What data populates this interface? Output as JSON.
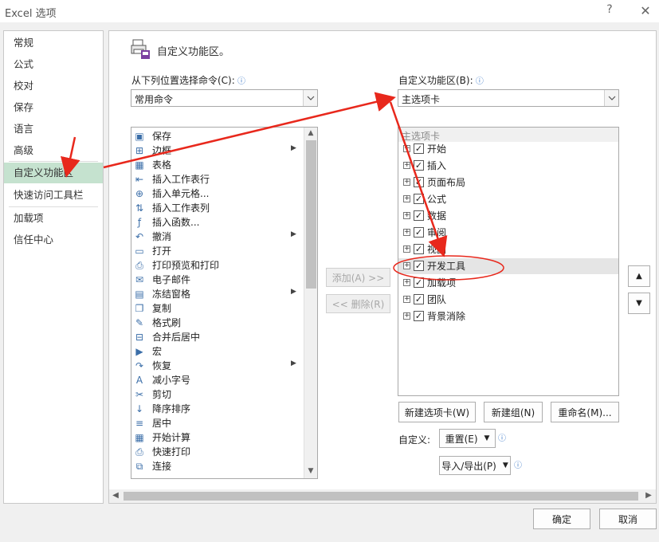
{
  "window": {
    "title": "Excel 选项",
    "help": "?",
    "close": "✕"
  },
  "nav": {
    "items": [
      {
        "label": "常规"
      },
      {
        "label": "公式"
      },
      {
        "label": "校对"
      },
      {
        "label": "保存"
      },
      {
        "label": "语言"
      },
      {
        "label": "高级"
      },
      {
        "label": "自定义功能区",
        "selected": true
      },
      {
        "label": "快速访问工具栏"
      },
      {
        "label": "加载项"
      },
      {
        "label": "信任中心"
      }
    ]
  },
  "main": {
    "heading": "自定义功能区。",
    "left_label": "从下列位置选择命令(C):",
    "left_combo": "常用命令",
    "right_label": "自定义功能区(B):",
    "right_combo": "主选项卡",
    "commands": [
      {
        "icon": "save-icon",
        "glyph": "▣",
        "label": "保存"
      },
      {
        "icon": "border-icon",
        "glyph": "⊞",
        "label": "边框",
        "submenu": true
      },
      {
        "icon": "table-icon",
        "glyph": "▦",
        "label": "表格"
      },
      {
        "icon": "insert-row-icon",
        "glyph": "⇤",
        "label": "插入工作表行"
      },
      {
        "icon": "insert-cell-icon",
        "glyph": "⊕",
        "label": "插入单元格..."
      },
      {
        "icon": "insert-column-icon",
        "glyph": "⇅",
        "label": "插入工作表列"
      },
      {
        "icon": "function-icon",
        "glyph": "ƒ",
        "label": "插入函数..."
      },
      {
        "icon": "undo-icon",
        "glyph": "↶",
        "label": "撤消",
        "submenu": true
      },
      {
        "icon": "open-folder-icon",
        "glyph": "▭",
        "label": "打开"
      },
      {
        "icon": "print-preview-icon",
        "glyph": "⎙",
        "label": "打印预览和打印"
      },
      {
        "icon": "email-icon",
        "glyph": "✉",
        "label": "电子邮件"
      },
      {
        "icon": "freeze-panes-icon",
        "glyph": "▤",
        "label": "冻结窗格",
        "submenu": true
      },
      {
        "icon": "copy-icon",
        "glyph": "❐",
        "label": "复制"
      },
      {
        "icon": "format-painter-icon",
        "glyph": "✎",
        "label": "格式刷"
      },
      {
        "icon": "merge-center-icon",
        "glyph": "⊟",
        "label": "合并后居中"
      },
      {
        "icon": "macro-icon",
        "glyph": "▶",
        "label": "宏"
      },
      {
        "icon": "redo-icon",
        "glyph": "↷",
        "label": "恢复",
        "submenu": true
      },
      {
        "icon": "decrease-font-icon",
        "glyph": "A",
        "label": "减小字号"
      },
      {
        "icon": "cut-icon",
        "glyph": "✂",
        "label": "剪切"
      },
      {
        "icon": "sort-descending-icon",
        "glyph": "↓",
        "label": "降序排序"
      },
      {
        "icon": "center-align-icon",
        "glyph": "≡",
        "label": "居中"
      },
      {
        "icon": "calculate-icon",
        "glyph": "▦",
        "label": "开始计算"
      },
      {
        "icon": "quick-print-icon",
        "glyph": "⎙",
        "label": "快速打印"
      },
      {
        "icon": "connection-icon",
        "glyph": "⧉",
        "label": "连接"
      }
    ],
    "tree": {
      "header": "主选项卡",
      "items": [
        {
          "label": "开始",
          "checked": "✓"
        },
        {
          "label": "插入",
          "checked": "✓"
        },
        {
          "label": "页面布局",
          "checked": "✓"
        },
        {
          "label": "公式",
          "checked": "✓"
        },
        {
          "label": "数据",
          "checked": "✓"
        },
        {
          "label": "审阅",
          "checked": "✓"
        },
        {
          "label": "视图",
          "checked": "✓"
        },
        {
          "label": "开发工具",
          "checked": "✓",
          "selected": true
        },
        {
          "label": "加载项",
          "checked": "✓"
        },
        {
          "label": "团队",
          "checked": "✓"
        },
        {
          "label": "背景消除",
          "checked": "✓"
        }
      ],
      "expand_glyph": "+"
    },
    "add_button": "添加(A) >>",
    "remove_button": "<< 删除(R)",
    "new_tab_button": "新建选项卡(W)",
    "new_group_button": "新建组(N)",
    "rename_button": "重命名(M)...",
    "customize_label": "自定义:",
    "reset_button": "重置(E)",
    "import_export_button": "导入/导出(P)",
    "move_up": "▲",
    "move_down": "▼"
  },
  "footer": {
    "ok": "确定",
    "cancel": "取消"
  },
  "colors": {
    "nav_selected": "#c5e2cf",
    "annotation_red": "#e8281c"
  }
}
